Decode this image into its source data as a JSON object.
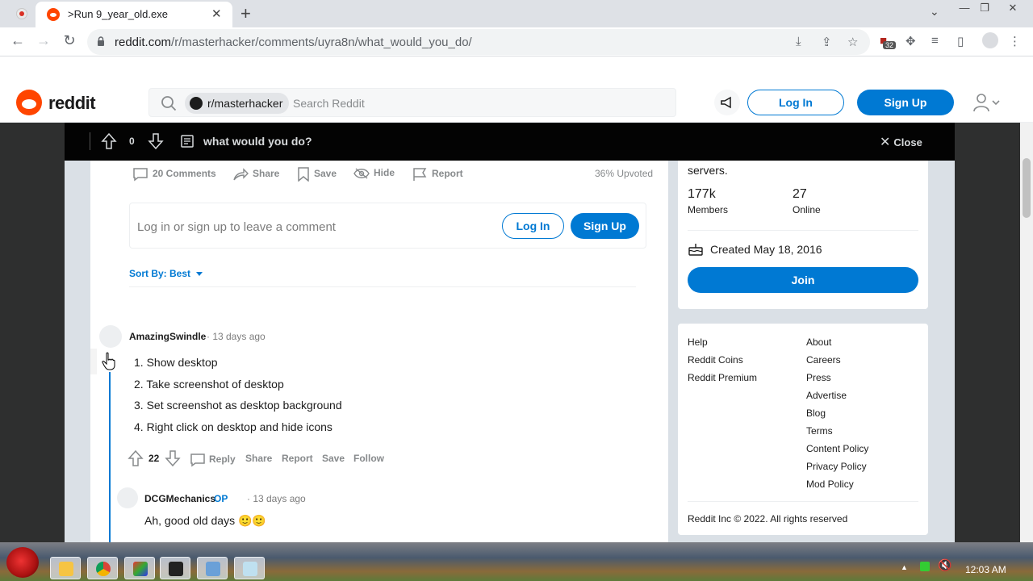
{
  "browser": {
    "tab_title": ">Run 9_year_old.exe",
    "url_host": "reddit.com",
    "url_path": "/r/masterhacker/comments/uyra8n/what_would_you_do/",
    "extension_badge": "32"
  },
  "header": {
    "logo": "reddit",
    "subreddit_chip": "r/masterhacker",
    "search_placeholder": "Search Reddit",
    "login": "Log In",
    "signup": "Sign Up"
  },
  "postbar": {
    "score": "0",
    "title": "what would you do?",
    "close": "Close"
  },
  "actions": {
    "comments": "20 Comments",
    "share": "Share",
    "save": "Save",
    "hide": "Hide",
    "report": "Report",
    "upvoted": "36% Upvoted"
  },
  "comment_box": {
    "placeholder": "Log in or sign up to leave a comment",
    "login": "Log In",
    "signup": "Sign Up",
    "sort": "Sort By: Best"
  },
  "comment1": {
    "author": "AmazingSwindle",
    "meta": "· 13 days ago",
    "items": [
      "1. Show desktop",
      "2. Take screenshot of desktop",
      "3. Set screenshot as desktop background",
      "4. Right click on desktop and hide icons"
    ],
    "score": "22",
    "reply": "Reply",
    "share": "Share",
    "report": "Report",
    "save": "Save",
    "follow": "Follow"
  },
  "comment2": {
    "author": "DCGMechanics",
    "op": "OP",
    "meta": "· 13 days ago",
    "text": "Ah, good old days 🙂🙂"
  },
  "sidebar": {
    "desc_tail": "servers.",
    "members_value": "177k",
    "members_label": "Members",
    "online_value": "27",
    "online_label": "Online",
    "created": "Created May 18, 2016",
    "join": "Join",
    "links_left": [
      "Help",
      "Reddit Coins",
      "Reddit Premium"
    ],
    "links_right": [
      "About",
      "Careers",
      "Press",
      "Advertise",
      "Blog",
      "Terms",
      "Content Policy",
      "Privacy Policy",
      "Mod Policy"
    ],
    "copyright": "Reddit Inc © 2022. All rights reserved"
  },
  "taskbar": {
    "time": "12:03 AM"
  },
  "colors": {
    "accent": "#0079d3",
    "brand": "#ff4500"
  }
}
